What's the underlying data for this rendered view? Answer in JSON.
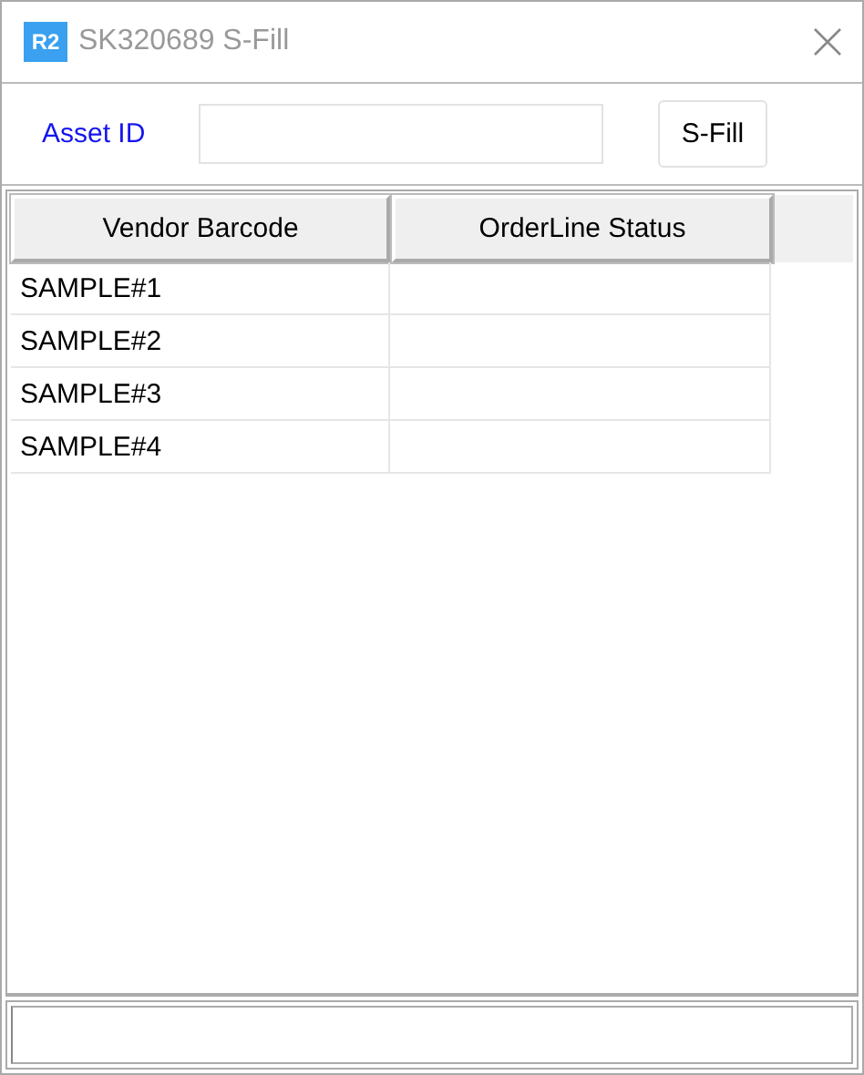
{
  "window": {
    "icon_text": "R2",
    "title": "SK320689 S-Fill"
  },
  "form": {
    "label": "Asset ID",
    "button": "S-Fill"
  },
  "table": {
    "columns": [
      "Vendor Barcode",
      "OrderLine Status"
    ],
    "rows": [
      [
        "SAMPLE#1"
      ],
      [
        "SAMPLE#2"
      ],
      [
        "SAMPLE#3"
      ],
      [
        "SAMPLE#4"
      ]
    ]
  }
}
